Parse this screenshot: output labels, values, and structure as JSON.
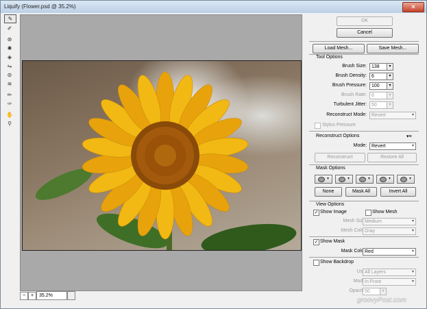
{
  "window": {
    "title": "Liquify (Flower.psd @ 35.2%)",
    "close_glyph": "✕"
  },
  "tools": [
    {
      "name": "forward-warp-tool-icon",
      "glyph": "✎",
      "active": true
    },
    {
      "name": "reconstruct-tool-icon",
      "glyph": "✐"
    },
    {
      "name": "twirl-clockwise-tool-icon",
      "glyph": "⊛",
      "gap": true
    },
    {
      "name": "pucker-tool-icon",
      "glyph": "✺"
    },
    {
      "name": "bloat-tool-icon",
      "glyph": "◈"
    },
    {
      "name": "push-left-tool-icon",
      "glyph": "⇋"
    },
    {
      "name": "mirror-tool-icon",
      "glyph": "⊜"
    },
    {
      "name": "turbulence-tool-icon",
      "glyph": "≋"
    },
    {
      "name": "freeze-mask-tool-icon",
      "glyph": "✏",
      "gap": true
    },
    {
      "name": "thaw-mask-tool-icon",
      "glyph": "✑"
    },
    {
      "name": "hand-tool-icon",
      "glyph": "✋",
      "gap": true
    },
    {
      "name": "zoom-tool-icon",
      "glyph": "⚲"
    }
  ],
  "status": {
    "zoom_minus": "−",
    "zoom_plus": "+",
    "zoom_value": "35.2%"
  },
  "buttons": {
    "ok": "OK",
    "cancel": "Cancel",
    "load_mesh": "Load Mesh...",
    "save_mesh": "Save Mesh...",
    "reconstruct": "Reconstruct",
    "restore_all": "Restore All",
    "none": "None",
    "mask_all": "Mask All",
    "invert_all": "Invert All"
  },
  "tool_options": {
    "heading": "Tool Options",
    "brush_size": {
      "label": "Brush Size:",
      "value": "138"
    },
    "brush_density": {
      "label": "Brush Density:",
      "value": "6"
    },
    "brush_pressure": {
      "label": "Brush Pressure:",
      "value": "100"
    },
    "brush_rate": {
      "label": "Brush Rate:",
      "value": "6"
    },
    "turbulent_jitter": {
      "label": "Turbulent Jitter:",
      "value": "50"
    },
    "reconstruct_mode": {
      "label": "Reconstruct Mode:",
      "value": "Revert"
    },
    "stylus_pressure": "Stylus Pressure"
  },
  "reconstruct_options": {
    "heading": "Reconstruct Options",
    "menu_glyph": "▾≡",
    "mode": {
      "label": "Mode:",
      "value": "Revert"
    }
  },
  "mask_options": {
    "heading": "Mask Options",
    "dropdown_glyph": "▾"
  },
  "view_options": {
    "heading": "View Options",
    "show_image": "Show Image",
    "show_mesh": "Show Mesh",
    "mesh_size": {
      "label": "Mesh Size:",
      "value": "Medium"
    },
    "mesh_color": {
      "label": "Mesh Color:",
      "value": "Gray"
    },
    "show_mask": "Show Mask",
    "mask_color": {
      "label": "Mask Color:",
      "value": "Red"
    },
    "show_backdrop": "Show Backdrop",
    "use": {
      "label": "Use:",
      "value": "All Layers"
    },
    "mode": {
      "label": "Mode:",
      "value": "In Front"
    },
    "opacity": {
      "label": "Opacity:",
      "value": "50"
    }
  },
  "glyphs": {
    "spin": "▾",
    "check": "✓"
  },
  "watermark": "groovyPost.com"
}
